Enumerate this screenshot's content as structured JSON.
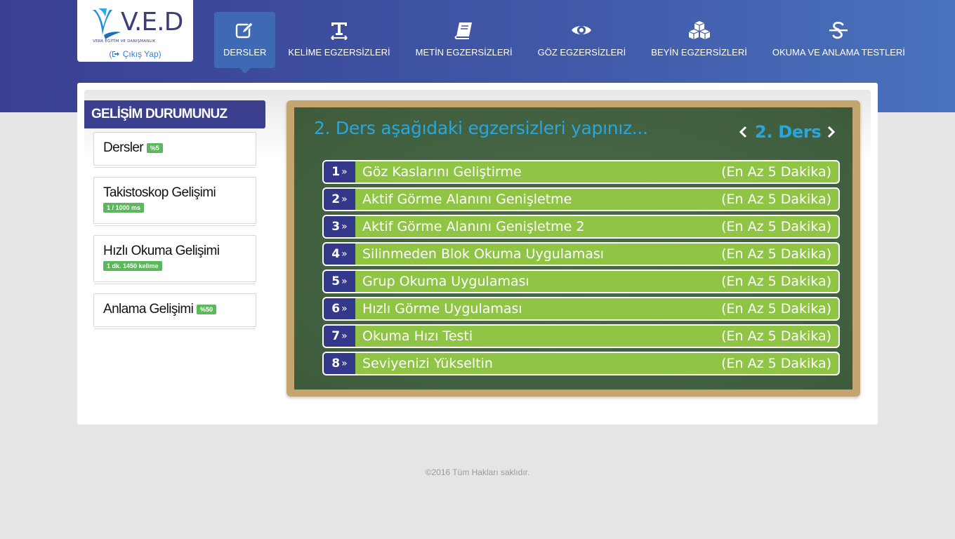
{
  "brand": {
    "logo_text": "V.E.D",
    "logo_sub": "VERA EĞİTİM VE DANIŞMANLIK",
    "logout_label": "Çıkış Yap"
  },
  "nav": {
    "items": [
      {
        "label": "DERSLER",
        "icon": "pencil-square-icon",
        "active": true
      },
      {
        "label": "KELİME EGZERSİZLERİ",
        "icon": "text-width-icon",
        "active": false
      },
      {
        "label": "METİN EGZERSİZLERİ",
        "icon": "book-icon",
        "active": false
      },
      {
        "label": "GÖZ EGZERSİZLERİ",
        "icon": "eye-icon",
        "active": false
      },
      {
        "label": "BEYİN EGZERSİZLERİ",
        "icon": "cubes-icon",
        "active": false
      },
      {
        "label": "OKUMA VE ANLAMA TESTLERİ",
        "icon": "strikethrough-icon",
        "active": false
      }
    ]
  },
  "sidebar": {
    "title": "GELİŞİM DURUMUNUZ",
    "cards": [
      {
        "title": "Dersler",
        "badge": "%5"
      },
      {
        "title": "Takistoskop Gelişimi",
        "badge": "1 / 1000 ms"
      },
      {
        "title": "Hızlı Okuma Gelişimi",
        "badge": "1 dk. 1450 kelime"
      },
      {
        "title": "Anlama Gelişimi",
        "badge": "%50"
      }
    ]
  },
  "board": {
    "title": "2. Ders aşağıdaki egzersizleri yapınız...",
    "lesson_label": "2. Ders",
    "exercises": [
      {
        "num": "1",
        "name": "Göz Kaslarını Geliştirme",
        "duration": "(En Az 5 Dakika)"
      },
      {
        "num": "2",
        "name": "Aktif Görme Alanını Genişletme",
        "duration": "(En Az 5 Dakika)"
      },
      {
        "num": "3",
        "name": "Aktif Görme Alanını Genişletme 2",
        "duration": "(En Az 5 Dakika)"
      },
      {
        "num": "4",
        "name": "Silinmeden Blok Okuma Uygulaması",
        "duration": "(En Az 5 Dakika)"
      },
      {
        "num": "5",
        "name": "Grup Okuma Uygulaması",
        "duration": "(En Az 5 Dakika)"
      },
      {
        "num": "6",
        "name": "Hızlı Görme Uygulaması",
        "duration": "(En Az 5 Dakika)"
      },
      {
        "num": "7",
        "name": "Okuma Hızı Testi",
        "duration": "(En Az 5 Dakika)"
      },
      {
        "num": "8",
        "name": "Seviyenizi Yükseltin",
        "duration": "(En Az 5 Dakika)"
      }
    ]
  },
  "footer": {
    "copyright": "©2016 Tüm Hakları saklıdır."
  },
  "colors": {
    "header": "#3a3f92",
    "accent_blue": "#29a6e0",
    "exercise_green": "#8fc445",
    "number_navy": "#33388a",
    "badge_green": "#5cb85c",
    "board_frame": "#c4a570"
  }
}
